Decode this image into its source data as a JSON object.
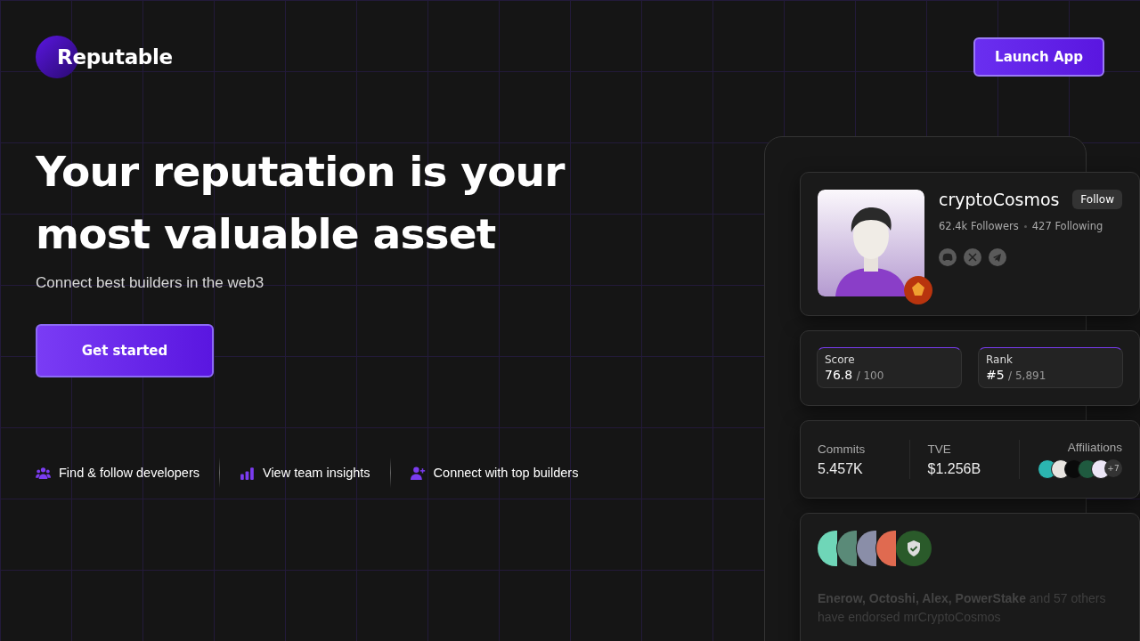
{
  "header": {
    "logo": "Reputable",
    "launch_button": "Launch App"
  },
  "hero": {
    "headline_lines": [
      "Your reputation is your",
      "most valuable asset"
    ],
    "subtitle": "Connect best builders in the web3",
    "cta_button": "Get started"
  },
  "features": [
    {
      "kind": "team",
      "label": "Find & follow developers"
    },
    {
      "kind": "chart",
      "label": "View team insights"
    },
    {
      "kind": "add-user",
      "label": "Connect with top builders"
    }
  ],
  "profile": {
    "name": "cryptoCosmos",
    "follow_button": "Follow",
    "followers": "62.4k Followers",
    "following": "427 Following",
    "socials": [
      {
        "kind": "discord"
      },
      {
        "kind": "x"
      },
      {
        "kind": "telegram"
      }
    ]
  },
  "scores": [
    {
      "label": "Score",
      "value": "76.8",
      "total": "/ 100"
    },
    {
      "label": "Rank",
      "value": "#5",
      "total": "/ 5,891"
    }
  ],
  "metrics": [
    {
      "label": "Commits",
      "value": "5.457K"
    },
    {
      "label": "TVE",
      "value": "$1.256B"
    }
  ],
  "affiliations": {
    "label": "Affiliations",
    "logos": [
      {
        "color": "#2bb5b0"
      },
      {
        "color": "#e8e4e0"
      },
      {
        "color": "#0a0a0a"
      },
      {
        "color": "#1f5a3f"
      },
      {
        "color": "#ece6f6"
      }
    ],
    "more": "+7"
  },
  "endorsements": {
    "avatars": [
      {
        "color": "#6fd6b8"
      },
      {
        "color": "#5a8a78"
      },
      {
        "color": "#8a8ea8"
      },
      {
        "color": "#e06a50"
      }
    ],
    "text": "**Enerow, Octoshi, Alex, PowerStake** and 57 others have endorsed mrCryptoCosmos"
  }
}
